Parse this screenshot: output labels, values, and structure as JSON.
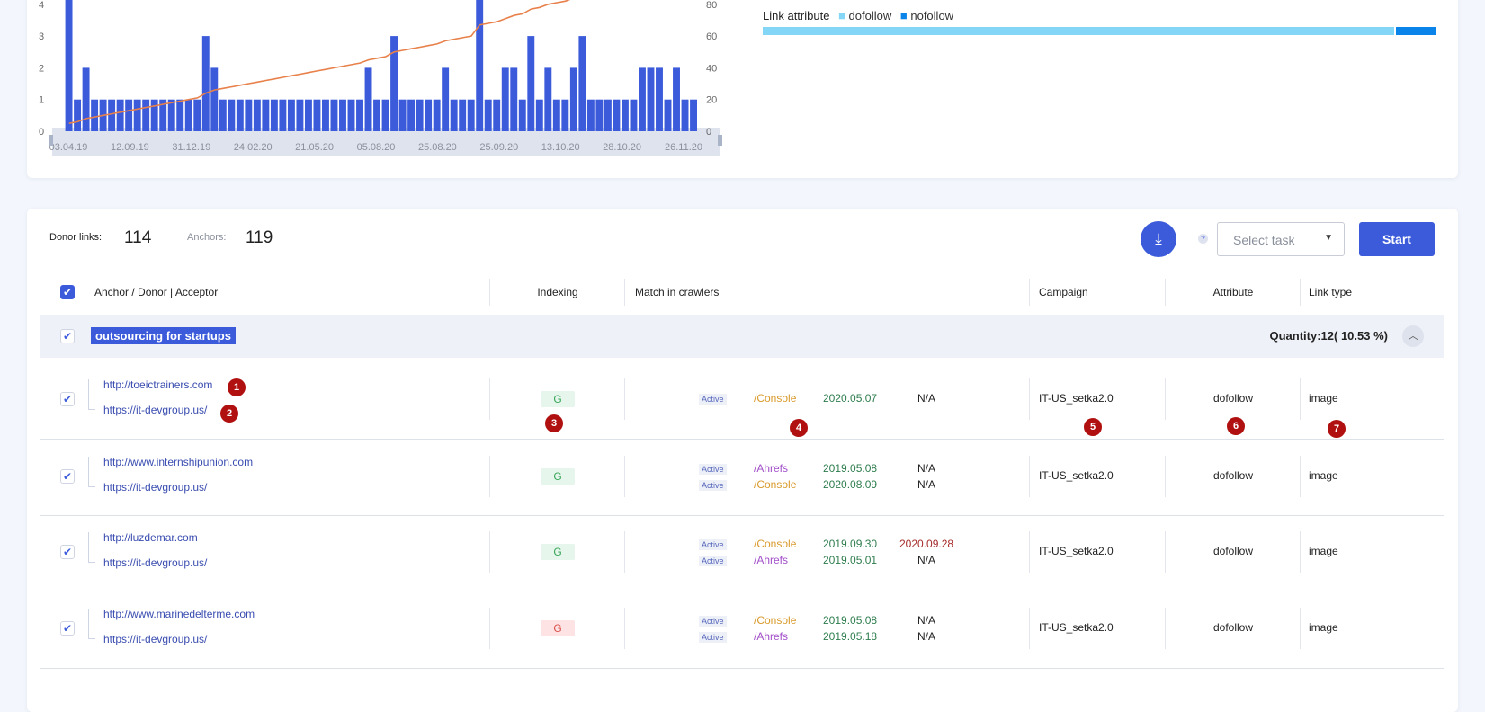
{
  "chart_data": {
    "type": "bar+line",
    "x_tick_labels": [
      "03.04.19",
      "12.09.19",
      "31.12.19",
      "24.02.20",
      "21.05.20",
      "05.08.20",
      "25.08.20",
      "25.09.20",
      "13.10.20",
      "28.10.20",
      "26.11.20"
    ],
    "left_axis_ticks": [
      0,
      1,
      2,
      3,
      4
    ],
    "right_axis_ticks": [
      0,
      20,
      40,
      60,
      80
    ],
    "ylim_left": [
      0,
      4.2
    ],
    "ylim_right": [
      0,
      84
    ],
    "series": [
      {
        "type": "bar",
        "values": [
          5,
          1,
          2,
          1,
          1,
          1,
          1,
          1,
          1,
          1,
          1,
          1,
          1,
          1,
          1,
          1,
          3,
          2,
          1,
          1,
          1,
          1,
          1,
          1,
          1,
          1,
          1,
          1,
          1,
          1,
          1,
          1,
          1,
          1,
          1,
          2,
          1,
          1,
          3,
          1,
          1,
          1,
          1,
          1,
          2,
          1,
          1,
          1,
          7,
          1,
          1,
          2,
          2,
          1,
          3,
          1,
          2,
          1,
          1,
          2,
          3,
          1,
          1,
          1,
          1,
          1,
          1,
          2,
          2,
          2,
          1,
          2,
          1,
          1
        ]
      },
      {
        "type": "line",
        "cumulative": true
      }
    ],
    "colors": {
      "bar": "#3b5bdb",
      "line": "#e8804a"
    }
  },
  "link_attribute": {
    "label": "Link attribute",
    "legend": [
      {
        "name": "dofollow",
        "color": "#84d6f7",
        "share": 0.94
      },
      {
        "name": "nofollow",
        "color": "#0a84e8",
        "share": 0.06
      }
    ]
  },
  "summary": {
    "donor_label": "Donor links:",
    "donor_value": "114",
    "anchors_label": "Anchors:",
    "anchors_value": "119"
  },
  "toolbar": {
    "help": "?",
    "select_placeholder": "Select task",
    "start": "Start"
  },
  "columns": [
    "Anchor / Donor | Acceptor",
    "Indexing",
    "Match in crawlers",
    "Campaign",
    "Attribute",
    "Link type"
  ],
  "group": {
    "anchor": "outsourcing for startups",
    "quantity": "Quantity:12( 10.53 %)"
  },
  "rows": [
    {
      "donor": "http://toeictrainers.com",
      "acceptor": "https://it-devgroup.us/",
      "indexing": "G",
      "indexing_status": "green",
      "crawlers": [
        {
          "status": "Active",
          "source": "/Console",
          "date": "2020.05.07",
          "lost": "N/A"
        }
      ],
      "campaign": "IT-US_setka2.0",
      "attribute": "dofollow",
      "link_type": "image"
    },
    {
      "donor": "http://www.internshipunion.com",
      "acceptor": "https://it-devgroup.us/",
      "indexing": "G",
      "indexing_status": "green",
      "crawlers": [
        {
          "status": "Active",
          "source": "/Ahrefs",
          "date": "2019.05.08",
          "lost": "N/A"
        },
        {
          "status": "Active",
          "source": "/Console",
          "date": "2020.08.09",
          "lost": "N/A"
        }
      ],
      "campaign": "IT-US_setka2.0",
      "attribute": "dofollow",
      "link_type": "image"
    },
    {
      "donor": "http://luzdemar.com",
      "acceptor": "https://it-devgroup.us/",
      "indexing": "G",
      "indexing_status": "green",
      "crawlers": [
        {
          "status": "Active",
          "source": "/Console",
          "date": "2019.09.30",
          "lost": "2020.09.28"
        },
        {
          "status": "Active",
          "source": "/Ahrefs",
          "date": "2019.05.01",
          "lost": "N/A"
        }
      ],
      "campaign": "IT-US_setka2.0",
      "attribute": "dofollow",
      "link_type": "image"
    },
    {
      "donor": "http://www.marinedelterme.com",
      "acceptor": "https://it-devgroup.us/",
      "indexing": "G",
      "indexing_status": "red",
      "crawlers": [
        {
          "status": "Active",
          "source": "/Console",
          "date": "2019.05.08",
          "lost": "N/A"
        },
        {
          "status": "Active",
          "source": "/Ahrefs",
          "date": "2019.05.18",
          "lost": "N/A"
        }
      ],
      "campaign": "IT-US_setka2.0",
      "attribute": "dofollow",
      "link_type": "image"
    }
  ],
  "markers": [
    "1",
    "2",
    "3",
    "4",
    "5",
    "6",
    "7"
  ]
}
